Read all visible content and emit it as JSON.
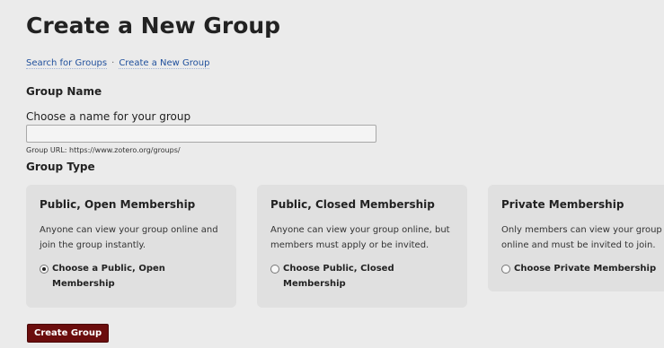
{
  "page": {
    "title": "Create a New Group"
  },
  "breadcrumb": {
    "items": [
      {
        "label": "Search for Groups"
      },
      {
        "label": "Create a New Group"
      }
    ],
    "separator": "·"
  },
  "group_name": {
    "heading": "Group Name",
    "label": "Choose a name for your group",
    "value": "",
    "url_hint": "Group URL: https://www.zotero.org/groups/"
  },
  "group_type": {
    "heading": "Group Type",
    "selected": "public_open",
    "options": [
      {
        "id": "public_open",
        "title": "Public, Open Membership",
        "description": "Anyone can view your group online and join the group instantly.",
        "radio_label": "Choose a Public, Open Membership",
        "checked": true
      },
      {
        "id": "public_closed",
        "title": "Public, Closed Membership",
        "description": "Anyone can view your group online, but members must apply or be invited.",
        "radio_label": "Choose Public, Closed Membership",
        "checked": false
      },
      {
        "id": "private",
        "title": "Private Membership",
        "description": "Only members can view your group online and must be invited to join.",
        "radio_label": "Choose Private Membership",
        "checked": false
      }
    ]
  },
  "actions": {
    "submit_label": "Create Group"
  },
  "colors": {
    "background": "#ebebeb",
    "card_background": "#e0e0e0",
    "link": "#1f4f9c",
    "button": "#6b0d0d"
  }
}
